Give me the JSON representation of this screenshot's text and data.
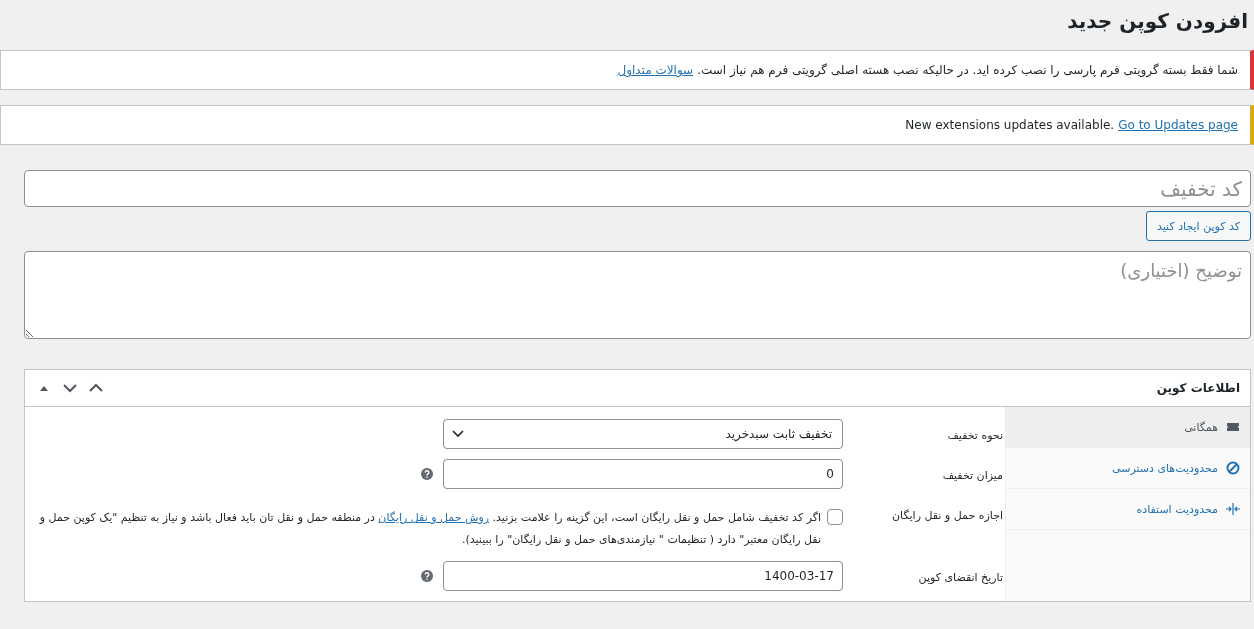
{
  "page_title": "افزودن کوپن جدید",
  "notices": [
    {
      "kind": "error",
      "text": "شما فقط بسته گرویتی فرم پارسی را نصب کرده اید. در حالیکه نصب هسته اصلی گرویتی فرم هم نیاز است.",
      "link": "سوالات متداول"
    },
    {
      "kind": "warning",
      "text": "New extensions updates available.",
      "link": "Go to Updates page"
    }
  ],
  "coupon_code": {
    "placeholder": "کد تخفیف"
  },
  "generate_button": "کد کوپن ایجاد کنید",
  "description": {
    "placeholder": "توضیح (اختیاری)"
  },
  "coupon_data": {
    "title": "اطلاعات کوپن",
    "tabs": [
      {
        "label": "همگانی",
        "kind": "ticket",
        "selected": true
      },
      {
        "label": "محدودیت‌های دسترسی",
        "kind": "blocked",
        "selected": false
      },
      {
        "label": "محدودیت استفاده",
        "kind": "limit",
        "selected": false
      }
    ],
    "fields": [
      {
        "kind": "select",
        "label": "نحوه تخفیف",
        "value": "تخفیف ثابت سبدخرید",
        "help": false
      },
      {
        "kind": "text",
        "label": "میزان تخفیف",
        "value": "0",
        "help": true
      },
      {
        "kind": "checkbox",
        "label": "اجازه حمل و نقل رایگان",
        "checked": false,
        "help": false,
        "text_before": "اگر کد تخفیف شامل حمل و نقل رایگان است، این گزینه را علامت بزنید.",
        "link": "روش حمل و نقل رایگان",
        "text_after": "در منطقه حمل و نقل تان باید فعال باشد و نیاز به تنظیم \"یک کوپن حمل و نقل رایگان معتبر\" دارد ( تنظیمات \" نیازمندی‌های حمل و نقل رایگان\" را ببینید)."
      },
      {
        "kind": "text",
        "label": "تاریخ انقضای کوپن",
        "value": "1400-03-17",
        "help": true
      }
    ]
  }
}
